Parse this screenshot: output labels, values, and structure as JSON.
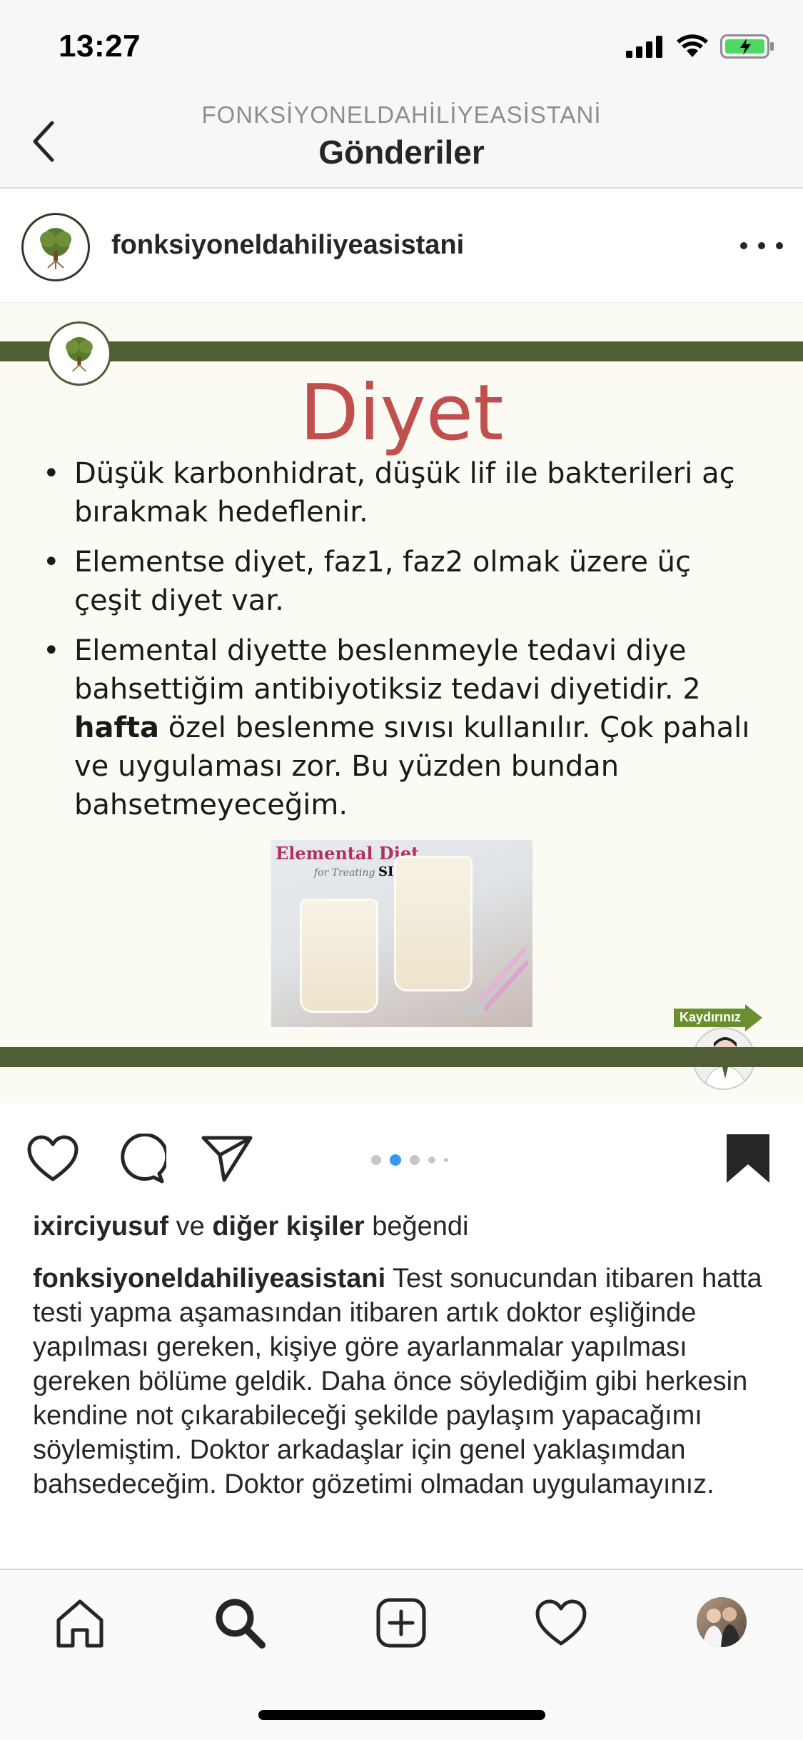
{
  "status_bar": {
    "time": "13:27"
  },
  "nav": {
    "subtitle": "FONKSİYONELDAHİLİYEASİSTANİ",
    "title": "Gönderiler"
  },
  "post": {
    "username": "fonksiyoneldahiliyeasistani",
    "slide": {
      "title": "Diyet",
      "bullets": [
        {
          "text": "Düşük karbonhidrat, düşük lif ile bakterileri aç bırakmak hedeflenir."
        },
        {
          "text": "Elementse diyet, faz1, faz2 olmak üzere üç çeşit diyet var."
        },
        {
          "before": "Elemental diyette beslenmeyle tedavi diye bahsettiğim antibiyotiksiz tedavi diyetidir. 2 ",
          "bold": "hafta",
          "after": " özel beslenme sıvısı kullanılır. Çok pahalı ve uygulaması zor. Bu yüzden bundan bahsetmeyeceğim."
        }
      ],
      "photo": {
        "title": "Elemental Diet",
        "subtitle": "for Treating",
        "subtitle_bold": "SIBO"
      },
      "next_label": "Kaydırınız"
    },
    "carousel": {
      "total": 5,
      "active": 1
    },
    "likes": {
      "user": "ixirciyusuf",
      "connector": " ve ",
      "others": "diğer kişiler",
      "suffix": " beğendi"
    },
    "caption": {
      "username": "fonksiyoneldahiliyeasistani",
      "text": " Test sonucundan itibaren hatta testi yapma aşamasından itibaren artık doktor eşliğinde yapılması gereken, kişiye göre ayarlanmalar yapılması gereken bölüme geldik. Daha önce söylediğim gibi herkesin kendine not çıkarabileceği şekilde paylaşım yapacağımı söylemiştim. Doktor arkadaşlar için genel yaklaşımdan bahsedeceğim. Doktor gözetimi olmadan uygulamayınız."
    }
  },
  "icons": {
    "back": "chevron-left-icon",
    "more": "more-horizontal-icon",
    "like": "heart-icon",
    "comment": "comment-icon",
    "share": "send-icon",
    "save": "bookmark-icon",
    "home": "home-icon",
    "search": "search-icon",
    "new_post": "plus-square-icon",
    "activity": "heart-icon"
  },
  "colors": {
    "slide_bar": "#4f5e34",
    "slide_title": "#c0504d",
    "carousel_active": "#3897f0",
    "battery": "#4cd964"
  }
}
